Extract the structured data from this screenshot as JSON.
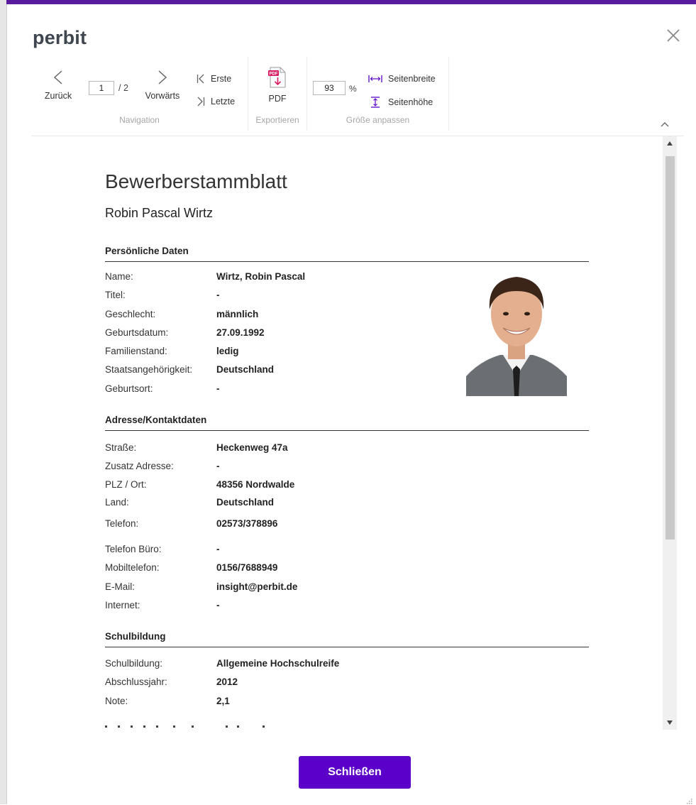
{
  "app": {
    "brand": "perbit"
  },
  "toolbar": {
    "back_label": "Zurück",
    "forward_label": "Vorwärts",
    "page_current": "1",
    "page_total": "/ 2",
    "first_label": "Erste",
    "last_label": "Letzte",
    "navigation_group": "Navigation",
    "pdf_label": "PDF",
    "export_group": "Exportieren",
    "zoom_value": "93",
    "zoom_unit": "%",
    "page_width_label": "Seitenbreite",
    "page_height_label": "Seitenhöhe",
    "size_group": "Größe anpassen"
  },
  "document": {
    "title": "Bewerberstammblatt",
    "applicant": "Robin Pascal Wirtz",
    "sections": {
      "personal": {
        "heading": "Persönliche Daten",
        "rows": [
          {
            "label": "Name:",
            "value": "Wirtz, Robin Pascal"
          },
          {
            "label": "Titel:",
            "value": "-"
          },
          {
            "label": "Geschlecht:",
            "value": "männlich"
          },
          {
            "label": "Geburtsdatum:",
            "value": "27.09.1992"
          },
          {
            "label": "Familienstand:",
            "value": "ledig"
          },
          {
            "label": "Staatsangehörigkeit:",
            "value": "Deutschland"
          },
          {
            "label": "Geburtsort:",
            "value": "-"
          }
        ]
      },
      "address": {
        "heading": "Adresse/Kontaktdaten",
        "rows": [
          {
            "label": "Straße:",
            "value": "Heckenweg 47a"
          },
          {
            "label": "Zusatz Adresse:",
            "value": "-"
          },
          {
            "label": "PLZ / Ort:",
            "value": "48356 Nordwalde"
          },
          {
            "label": "Land:",
            "value": "Deutschland"
          },
          {
            "label": "Telefon:",
            "value": "02573/378896"
          },
          {
            "label": "Telefon Büro:",
            "value": "-"
          },
          {
            "label": "Mobiltelefon:",
            "value": "0156/7688949"
          },
          {
            "label": "E-Mail:",
            "value": "insight@perbit.de"
          },
          {
            "label": "Internet:",
            "value": "-"
          }
        ]
      },
      "school": {
        "heading": "Schulbildung",
        "rows": [
          {
            "label": "Schulbildung:",
            "value": "Allgemeine Hochschulreife"
          },
          {
            "label": "Abschlussjahr:",
            "value": "2012"
          },
          {
            "label": "Note:",
            "value": "2,1"
          }
        ]
      }
    }
  },
  "footer": {
    "close_label": "Schließen"
  },
  "colors": {
    "accent": "#5a00c8",
    "brand_text": "#3f4650",
    "pdf_icon": "#d81b60"
  }
}
